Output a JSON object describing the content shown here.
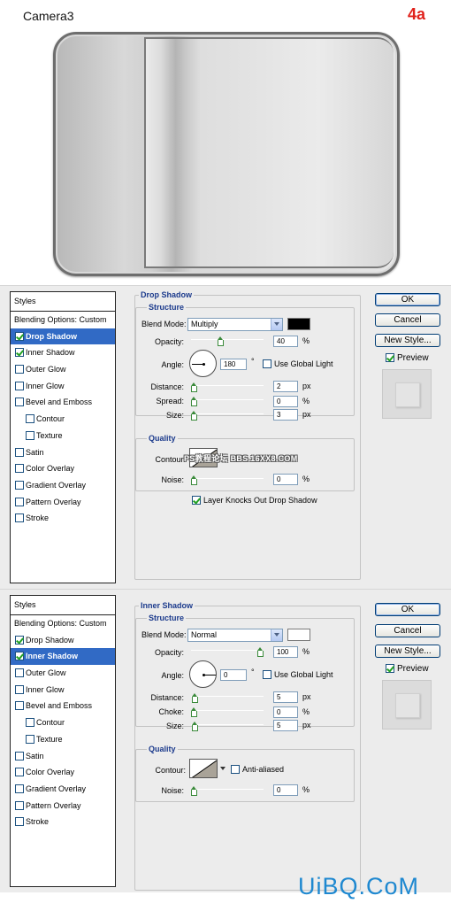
{
  "illustration": {
    "title": "Camera3",
    "step": "4a"
  },
  "watermark": "PS教程论坛 BBS.16XX8.COM",
  "site_logo": "UiBQ.CoM",
  "buttons": {
    "ok": "OK",
    "cancel": "Cancel",
    "new_style": "New Style...",
    "preview": "Preview"
  },
  "styles_header": "Styles",
  "dialog1": {
    "section_title": "Drop Shadow",
    "structure_title": "Structure",
    "quality_title": "Quality",
    "styles": [
      {
        "label": "Blending Options: Custom",
        "type": "plain"
      },
      {
        "label": "Drop Shadow",
        "checked": true,
        "selected": true
      },
      {
        "label": "Inner Shadow",
        "checked": true
      },
      {
        "label": "Outer Glow",
        "checked": false
      },
      {
        "label": "Inner Glow",
        "checked": false
      },
      {
        "label": "Bevel and Emboss",
        "checked": false
      },
      {
        "label": "Contour",
        "checked": false,
        "indent": true
      },
      {
        "label": "Texture",
        "checked": false,
        "indent": true
      },
      {
        "label": "Satin",
        "checked": false
      },
      {
        "label": "Color Overlay",
        "checked": false
      },
      {
        "label": "Gradient Overlay",
        "checked": false
      },
      {
        "label": "Pattern Overlay",
        "checked": false
      },
      {
        "label": "Stroke",
        "checked": false
      }
    ],
    "blend_mode_label": "Blend Mode:",
    "blend_mode": "Multiply",
    "color": "#000000",
    "opacity_label": "Opacity:",
    "opacity": "40",
    "opacity_fraction": 0.4,
    "percent": "%",
    "angle_label": "Angle:",
    "angle": "180",
    "degree": "°",
    "global_light": "Use Global Light",
    "distance_label": "Distance:",
    "distance": "2",
    "spread_label": "Spread:",
    "spread": "0",
    "size_label": "Size:",
    "size": "3",
    "px": "px",
    "contour_label": "Contour:",
    "noise_label": "Noise:",
    "noise": "0",
    "knockout": "Layer Knocks Out Drop Shadow",
    "knockout_checked": true
  },
  "dialog2": {
    "section_title": "Inner Shadow",
    "structure_title": "Structure",
    "quality_title": "Quality",
    "styles": [
      {
        "label": "Blending Options: Custom",
        "type": "plain"
      },
      {
        "label": "Drop Shadow",
        "checked": true
      },
      {
        "label": "Inner Shadow",
        "checked": true,
        "selected": true
      },
      {
        "label": "Outer Glow",
        "checked": false
      },
      {
        "label": "Inner Glow",
        "checked": false
      },
      {
        "label": "Bevel and Emboss",
        "checked": false
      },
      {
        "label": "Contour",
        "checked": false,
        "indent": true
      },
      {
        "label": "Texture",
        "checked": false,
        "indent": true
      },
      {
        "label": "Satin",
        "checked": false
      },
      {
        "label": "Color Overlay",
        "checked": false
      },
      {
        "label": "Gradient Overlay",
        "checked": false
      },
      {
        "label": "Pattern Overlay",
        "checked": false
      },
      {
        "label": "Stroke",
        "checked": false
      }
    ],
    "blend_mode_label": "Blend Mode:",
    "blend_mode": "Normal",
    "color": "#ffffff",
    "opacity_label": "Opacity:",
    "opacity": "100",
    "opacity_fraction": 1.0,
    "percent": "%",
    "angle_label": "Angle:",
    "angle": "0",
    "degree": "°",
    "global_light": "Use Global Light",
    "distance_label": "Distance:",
    "distance": "5",
    "choke_label": "Choke:",
    "choke": "0",
    "size_label": "Size:",
    "size": "5",
    "px": "px",
    "contour_label": "Contour:",
    "anti_aliased": "Anti-aliased",
    "noise_label": "Noise:",
    "noise": "0"
  }
}
